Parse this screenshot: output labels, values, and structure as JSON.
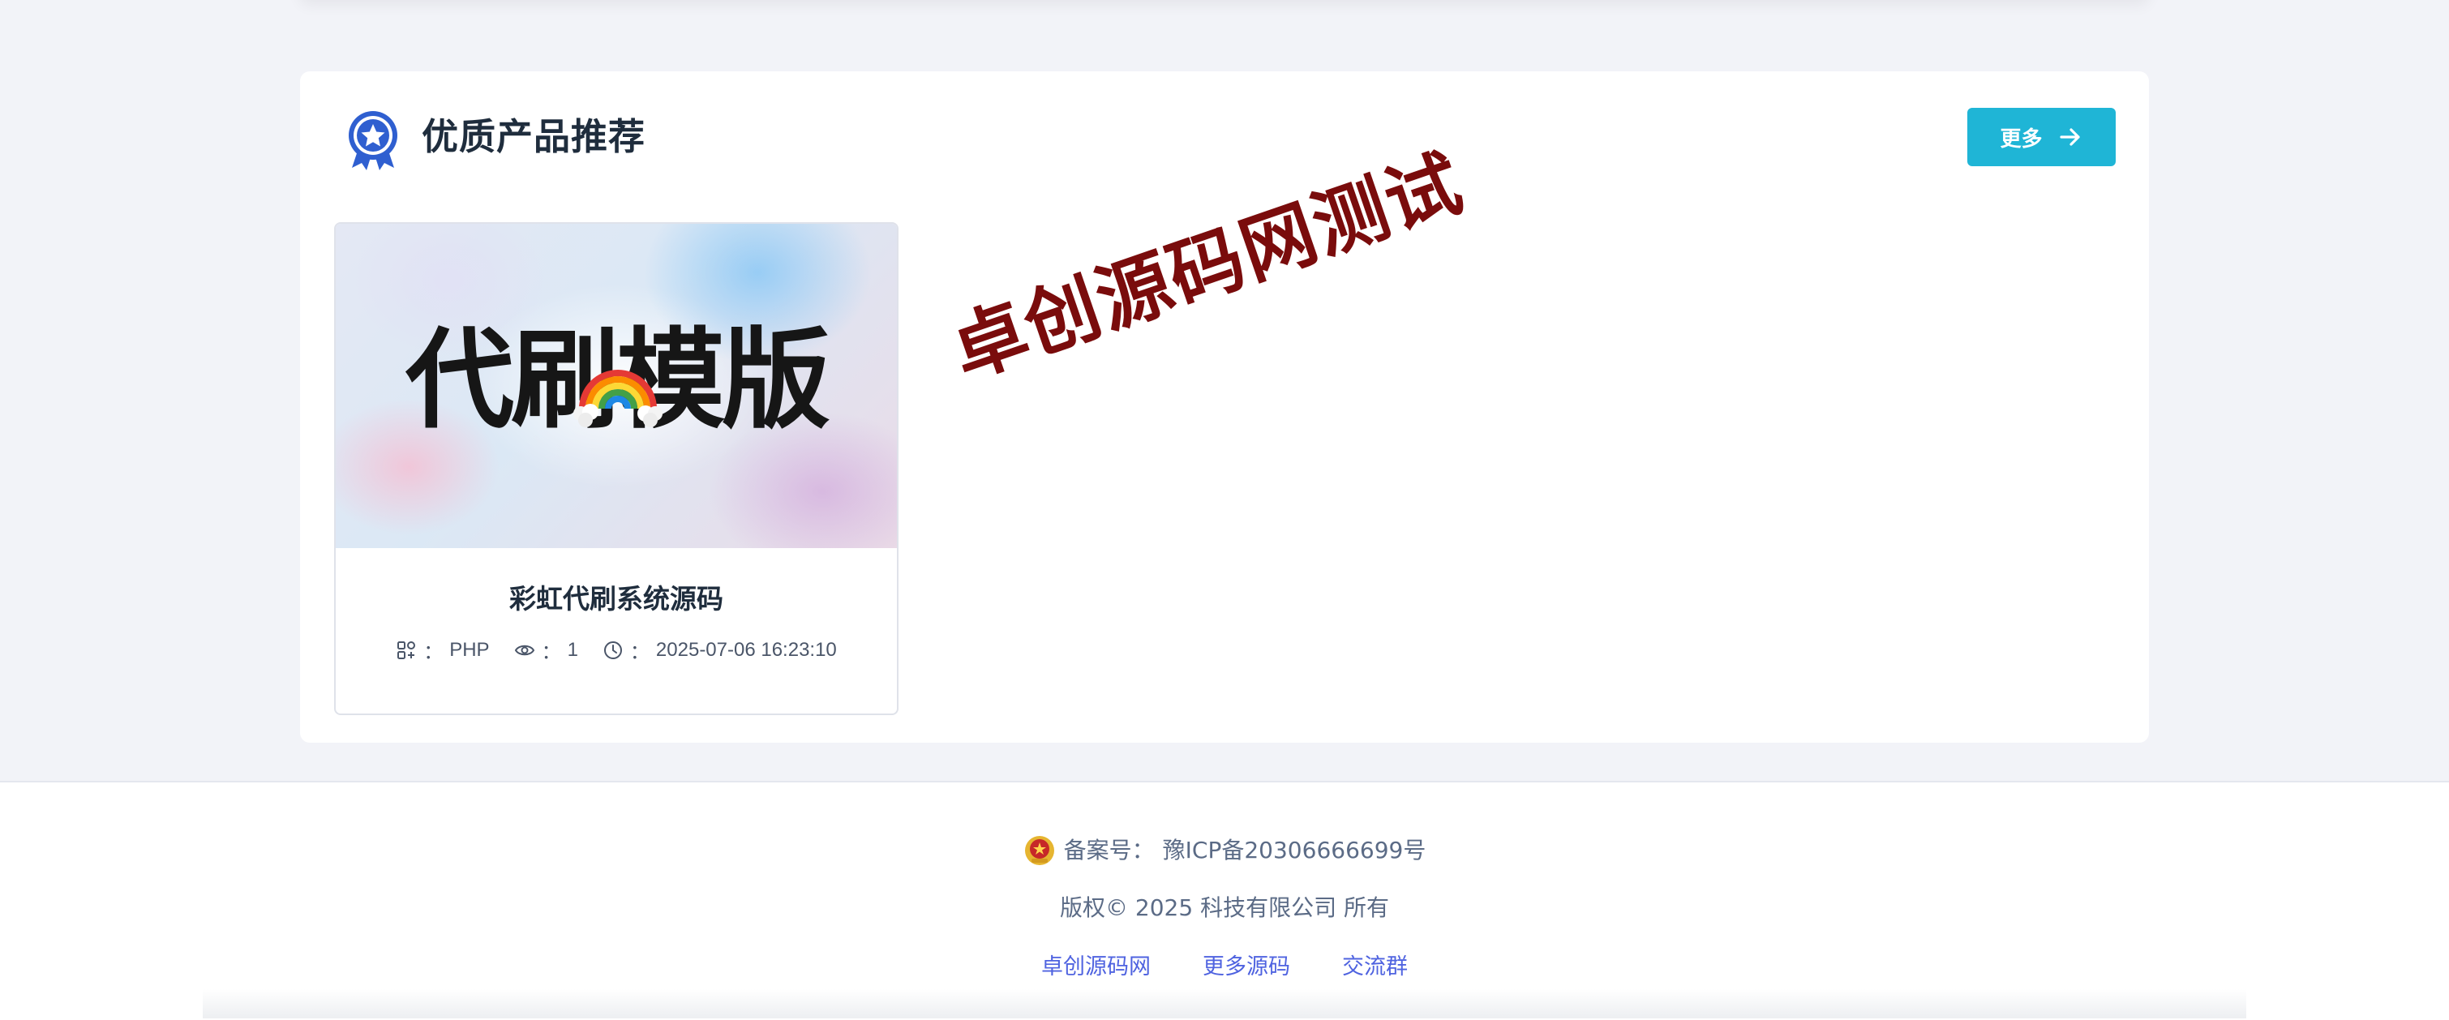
{
  "section": {
    "title": "优质产品推荐",
    "more_label": "更多"
  },
  "product": {
    "thumb_text": "代刷模版",
    "title": "彩虹代刷系统源码",
    "lang_label": "：",
    "lang": "PHP",
    "views_label": "：",
    "views": "1",
    "time_label": "：",
    "time": "2025-07-06 16:23:10"
  },
  "watermark": "卓创源码网测试",
  "footer": {
    "icp_label": "备案号：",
    "icp_number": "豫ICP备20306666699号",
    "copyright": "版权© 2025 科技有限公司 所有",
    "links": [
      "卓创源码网",
      "更多源码",
      "交流群"
    ]
  },
  "colors": {
    "accent": "#1fb5d6",
    "link": "#4f63e0",
    "watermark": "#7a0c0c",
    "badge": "#2f5fd0"
  }
}
